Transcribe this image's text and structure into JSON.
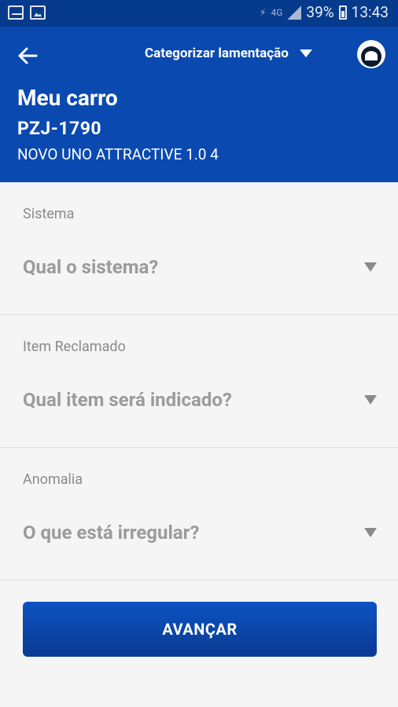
{
  "status_bar": {
    "notification_icons": [
      "mail-notification-icon",
      "image-notification-icon"
    ],
    "network": "4G",
    "battery": "39%",
    "time": "13:43"
  },
  "header": {
    "category_label": "Categorizar lamentação",
    "title": "Meu carro",
    "plate": "PZJ-1790",
    "model": "NOVO UNO ATTRACTIVE 1.0 4"
  },
  "form": {
    "fields": [
      {
        "label": "Sistema",
        "placeholder": "Qual o sistema?"
      },
      {
        "label": "Item Reclamado",
        "placeholder": "Qual item será indicado?"
      },
      {
        "label": "Anomalia",
        "placeholder": "O que está irregular?"
      }
    ]
  },
  "actions": {
    "advance_label": "AVANÇAR"
  },
  "colors": {
    "status_bar": "#063a8c",
    "header": "#0a4ab0",
    "button_top": "#0d53c2",
    "button_bottom": "#0a3a92",
    "background": "#f5f5f5"
  }
}
